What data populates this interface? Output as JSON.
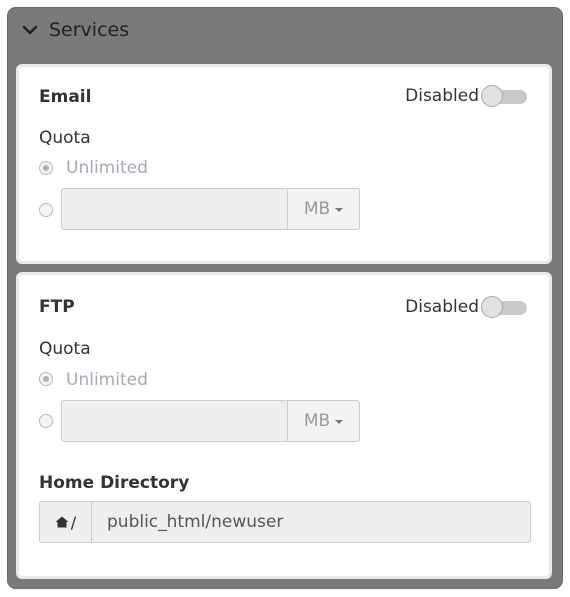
{
  "panel": {
    "title": "Services"
  },
  "email": {
    "title": "Email",
    "toggle_label": "Disabled",
    "quota_label": "Quota",
    "unlimited_label": "Unlimited",
    "quota_value": "",
    "unit": "MB"
  },
  "ftp": {
    "title": "FTP",
    "toggle_label": "Disabled",
    "quota_label": "Quota",
    "unlimited_label": "Unlimited",
    "quota_value": "",
    "unit": "MB",
    "home_label": "Home Directory",
    "home_prefix": "/",
    "home_value": "public_html/newuser"
  }
}
